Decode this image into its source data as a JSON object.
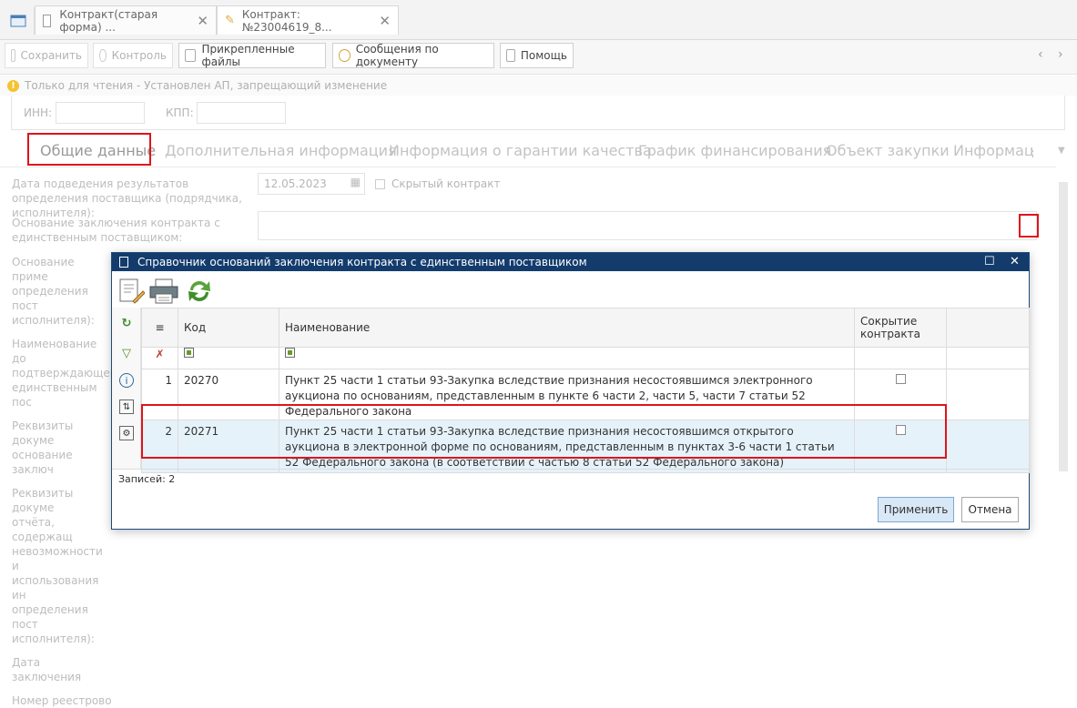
{
  "window": {
    "tabs": [
      {
        "label": "Контракт(старая форма) ...",
        "close": "✕"
      },
      {
        "label": "Контракт: №23004619_8...",
        "close": "✕"
      }
    ]
  },
  "toolbar": {
    "save": "Сохранить",
    "control": "Контроль",
    "attached_files": "Прикрепленные файлы",
    "messages": "Сообщения по документу",
    "help": "Помощь",
    "prev": "‹",
    "next": "›"
  },
  "infobar": {
    "icon": "!",
    "text": "Только для чтения - Установлен АП, запрещающий изменение"
  },
  "form_top": {
    "inn_label": "ИНН:",
    "kpp_label": "КПП:"
  },
  "section_tabs": [
    "Общие данные",
    "Дополнительная информация",
    "Информация о гарантии качества",
    "График финансирования",
    "Объект закупки",
    "Информац"
  ],
  "form": {
    "result_date_label": "Дата подведения результатов определения поставщика (подрядчика, исполнителя):",
    "result_date_value": "12.05.2023",
    "hidden_contract_label": "Скрытый контракт",
    "single_supplier_label": "Основание заключения контракта с единственным поставщиком:",
    "partial_labels": [
      "Основание приме",
      "определения пост",
      "исполнителя):",
      "Наименование до",
      "подтверждающего",
      "единственным пос",
      "Реквизиты докуме",
      "основание заключ",
      "Реквизиты докуме",
      "отчёта, содержащ",
      "невозможности и",
      "использования ин",
      "определения пост",
      "исполнителя):",
      "Дата заключения",
      "Номер реестрово"
    ]
  },
  "dialog": {
    "title": "Справочник оснований заключения контракта с единственным поставщиком",
    "maximize": "☐",
    "close": "✕",
    "columns": {
      "code": "Код",
      "name": "Наименование",
      "hide": "Сокрытие контракта"
    },
    "rows": [
      {
        "num": "1",
        "code": "20270",
        "name": "Пункт 25 части 1 статьи 93-Закупка вследствие признания несостоявшимся электронного аукциона по основаниям, представленным в пункте 6 части 2, части 5, части 7 статьи 52 Федерального закона",
        "hidden": false
      },
      {
        "num": "2",
        "code": "20271",
        "name": "Пункт 25 части 1 статьи 93-Закупка вследствие признания несостоявшимся открытого аукциона в электронной форме по основаниям, представленным в пунктах 3-6 части 1 статьи 52 Федерального закона (в соответствии с частью 8 статьи 52 Федерального закона)",
        "hidden": false
      }
    ],
    "records": "Записей: 2",
    "apply": "Применить",
    "cancel": "Отмена"
  },
  "colors": {
    "title_bar": "#133c6d",
    "highlight": "#e0141a",
    "selected_row": "#e6f2fa"
  }
}
